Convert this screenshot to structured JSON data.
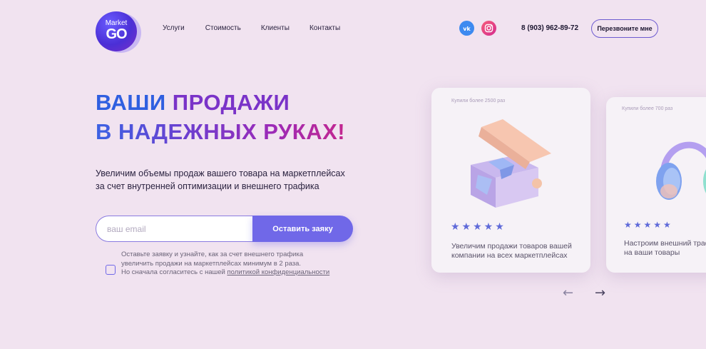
{
  "logo": {
    "top_text": "Market",
    "bottom_text": "GO"
  },
  "nav": {
    "items": [
      "Услуги",
      "Стоимость",
      "Клиенты",
      "Контакты"
    ]
  },
  "social": {
    "vk_icon": "vk-icon",
    "instagram_icon": "instagram-icon"
  },
  "phone": "8 (903) 962-89-72",
  "callback_label": "Перезвоните мне",
  "hero": {
    "line1_a": "ВАШИ",
    "line1_b": "ПРОДАЖИ",
    "line2": "В НАДЕЖНЫХ РУКАХ!",
    "subtitle_line1": "Увеличим объемы продаж вашего товара на маркетплейсах",
    "subtitle_line2": "за счет внутренней оптимизации и внешнего трафика"
  },
  "form": {
    "email_placeholder": "ваш email",
    "submit_label": "Оставить заяку"
  },
  "note": {
    "line1": "Оставьте заявку и узнайте, как за счет внешнего трафика",
    "line2": "увеличить продажи на маркетплейсах минимум в 2 раза.",
    "line3_prefix": "Но сначала согласитесь с нашей ",
    "line3_link": "политикой конфиденциальности"
  },
  "cards": [
    {
      "caption": "Купили более 2500 раз",
      "stars": "★★★★★",
      "text": "Увеличим продажи товаров вашей компании на всех маркетплейсах"
    },
    {
      "caption": "Купили более 700 раз",
      "stars": "★★★★★",
      "text": "Настроим внешний трафик на ваши товары"
    }
  ],
  "carousel": {
    "prev": "←",
    "next": "→"
  },
  "colors": {
    "background": "#f1e3f0",
    "accent": "#7068e8",
    "blue": "#2f5fe0",
    "purple": "#7a33c8"
  }
}
